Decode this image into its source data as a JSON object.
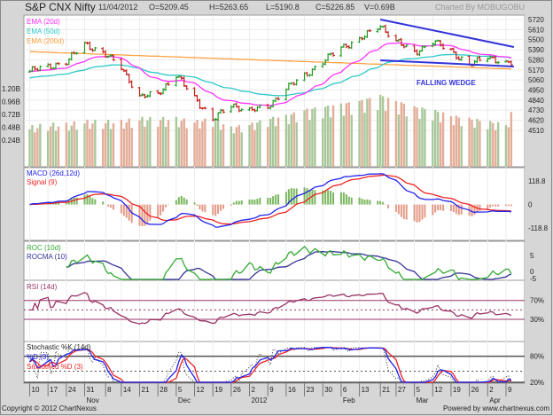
{
  "header": {
    "symbol": "S&P CNX Nifty",
    "date": "11/04/2012",
    "open": "O=5209.45",
    "high": "H=5263.65",
    "low": "L=5190.8",
    "close": "C=5226.85",
    "volume": "V=0.69B",
    "charted_by": "Charted By MOBUGOBU"
  },
  "footer": {
    "copyright": "Copyright © 2012 ChartNexus",
    "powered_by": "Powered by www.chartnexus.com"
  },
  "colors": {
    "up": "#1f9a1f",
    "down": "#c81e1e",
    "ema20": "#ff33ff",
    "ema50": "#2cc8c8",
    "ema200": "#ffa040",
    "wedge": "#3333dd",
    "macd": "#2222ee",
    "signal": "#ee2222",
    "roc": "#33aa33",
    "rocma": "#333399",
    "rsi": "#993366"
  },
  "chart_data": {
    "type": "ohlc",
    "title": "S&P CNX Nifty",
    "price_ticks": [
      "5720",
      "5610",
      "5500",
      "5390",
      "5280",
      "5170",
      "5060",
      "4950",
      "4840",
      "4730",
      "4620",
      "4510"
    ],
    "volume_ticks": [
      "1.20B",
      "0.96B",
      "0.72B",
      "0.48B",
      "0.24B"
    ],
    "x_ticks": [
      {
        "date": "2011-10-10",
        "label": "10"
      },
      {
        "date": "2011-10-17",
        "label": "17"
      },
      {
        "date": "2011-10-24",
        "label": "24"
      },
      {
        "date": "2011-10-31",
        "label": "31",
        "month": "Nov"
      },
      {
        "date": "2011-11-08",
        "label": "8"
      },
      {
        "date": "2011-11-14",
        "label": "14"
      },
      {
        "date": "2011-11-21",
        "label": "21"
      },
      {
        "date": "2011-11-28",
        "label": "28"
      },
      {
        "date": "2011-12-05",
        "label": "5",
        "month": "Dec"
      },
      {
        "date": "2011-12-12",
        "label": "12"
      },
      {
        "date": "2011-12-19",
        "label": "19"
      },
      {
        "date": "2011-12-26",
        "label": "26"
      },
      {
        "date": "2012-01-02",
        "label": "2",
        "month": "2012"
      },
      {
        "date": "2012-01-09",
        "label": "9"
      },
      {
        "date": "2012-01-16",
        "label": "16"
      },
      {
        "date": "2012-01-23",
        "label": "23"
      },
      {
        "date": "2012-01-30",
        "label": "30"
      },
      {
        "date": "2012-02-06",
        "label": "6",
        "month": "Feb"
      },
      {
        "date": "2012-02-13",
        "label": "13"
      },
      {
        "date": "2012-02-21",
        "label": "21"
      },
      {
        "date": "2012-02-27",
        "label": "27"
      },
      {
        "date": "2012-03-05",
        "label": "5",
        "month": "Mar"
      },
      {
        "date": "2012-03-12",
        "label": "12"
      },
      {
        "date": "2012-03-19",
        "label": "19"
      },
      {
        "date": "2012-03-26",
        "label": "26"
      },
      {
        "date": "2012-04-02",
        "label": "2",
        "month": "Apr"
      },
      {
        "date": "2012-04-09",
        "label": "9"
      }
    ],
    "close_anchors": [
      {
        "date": "2011-10-10",
        "close": 5158,
        "volume": 0.45
      },
      {
        "date": "2011-10-17",
        "close": 5207,
        "volume": 0.5
      },
      {
        "date": "2011-10-24",
        "close": 5255,
        "volume": 0.5
      },
      {
        "date": "2011-10-31",
        "close": 5460,
        "volume": 0.55
      },
      {
        "date": "2011-11-08",
        "close": 5333,
        "volume": 0.55
      },
      {
        "date": "2011-11-14",
        "close": 5207,
        "volume": 0.55
      },
      {
        "date": "2011-11-21",
        "close": 4868,
        "volume": 0.6
      },
      {
        "date": "2011-11-28",
        "close": 4916,
        "volume": 0.6
      },
      {
        "date": "2011-12-05",
        "close": 5110,
        "volume": 0.6
      },
      {
        "date": "2011-12-12",
        "close": 4868,
        "volume": 0.55
      },
      {
        "date": "2011-12-19",
        "close": 4626,
        "volume": 0.6
      },
      {
        "date": "2011-12-26",
        "close": 4790,
        "volume": 0.45
      },
      {
        "date": "2012-01-02",
        "close": 4723,
        "volume": 0.5
      },
      {
        "date": "2012-01-09",
        "close": 4771,
        "volume": 0.6
      },
      {
        "date": "2012-01-16",
        "close": 4965,
        "volume": 0.65
      },
      {
        "date": "2012-01-23",
        "close": 5110,
        "volume": 0.75
      },
      {
        "date": "2012-01-30",
        "close": 5255,
        "volume": 0.8
      },
      {
        "date": "2012-02-06",
        "close": 5420,
        "volume": 0.85
      },
      {
        "date": "2012-02-13",
        "close": 5497,
        "volume": 0.9
      },
      {
        "date": "2012-02-21",
        "close": 5660,
        "volume": 1.0
      },
      {
        "date": "2012-02-27",
        "close": 5480,
        "volume": 0.9
      },
      {
        "date": "2012-03-05",
        "close": 5360,
        "volume": 0.8
      },
      {
        "date": "2012-03-12",
        "close": 5480,
        "volume": 0.75
      },
      {
        "date": "2012-03-19",
        "close": 5380,
        "volume": 0.65
      },
      {
        "date": "2012-03-26",
        "close": 5220,
        "volume": 0.6
      },
      {
        "date": "2012-04-02",
        "close": 5320,
        "volume": 0.55
      },
      {
        "date": "2012-04-09",
        "close": 5240,
        "volume": 0.5
      },
      {
        "date": "2012-04-11",
        "close": 5226.85,
        "volume": 0.69
      }
    ],
    "ema20_start": 5150,
    "ema50_start": 5080,
    "ema200_range": [
      5370,
      5180
    ],
    "legend_price": [
      "EMA (20d)",
      "EMA (50d)",
      "EMA (200d)"
    ],
    "wedge": {
      "label": "FALLING WEDGE",
      "upper": [
        {
          "date": "2012-02-21",
          "price": 5720
        },
        {
          "date": "2012-04-11",
          "price": 5420
        }
      ],
      "lower": [
        {
          "date": "2012-02-21",
          "price": 5275
        },
        {
          "date": "2012-04-11",
          "price": 5207
        }
      ]
    },
    "macd": {
      "legend": [
        "MACD (26d,12d)",
        "Signal (9)"
      ],
      "ticks": [
        "118.8",
        "0",
        "-118.8"
      ]
    },
    "roc": {
      "legend": [
        "ROC (10d)",
        "ROCMA (10)"
      ],
      "ticks": [
        "5",
        "0",
        "-5"
      ]
    },
    "rsi": {
      "legend": [
        "RSI (14d)"
      ],
      "ticks": [
        "70%",
        "30%"
      ]
    },
    "stochastic": {
      "legend": [
        "Stochastic %K (14d)",
        "%D (3)",
        "Smoothed %D (3)"
      ],
      "ticks": [
        "80%",
        "20%"
      ]
    }
  }
}
